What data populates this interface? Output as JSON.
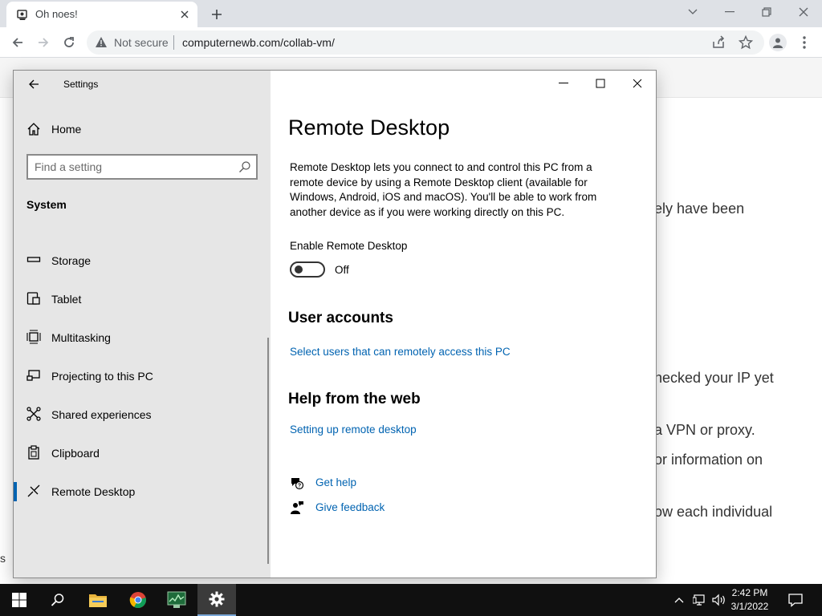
{
  "browser": {
    "tab_title": "Oh noes!",
    "not_secure_label": "Not secure",
    "url": "computernewb.com/collab-vm/"
  },
  "background_page": {
    "fragments": [
      "ely have been",
      "hecked your IP yet",
      "a VPN or proxy.",
      "or information on",
      "ow each individual",
      "s"
    ]
  },
  "settings": {
    "window_title": "Settings",
    "home_label": "Home",
    "search_placeholder": "Find a setting",
    "section_title": "System",
    "nav_items": [
      {
        "label": "Storage",
        "icon": "storage-icon"
      },
      {
        "label": "Tablet",
        "icon": "tablet-icon"
      },
      {
        "label": "Multitasking",
        "icon": "multitasking-icon"
      },
      {
        "label": "Projecting to this PC",
        "icon": "projecting-icon"
      },
      {
        "label": "Shared experiences",
        "icon": "shared-experiences-icon"
      },
      {
        "label": "Clipboard",
        "icon": "clipboard-icon"
      },
      {
        "label": "Remote Desktop",
        "icon": "remote-desktop-icon",
        "active": true
      }
    ],
    "page": {
      "title": "Remote Desktop",
      "description": "Remote Desktop lets you connect to and control this PC from a remote device by using a Remote Desktop client (available for Windows, Android, iOS and macOS). You'll be able to work from another device as if you were working directly on this PC.",
      "toggle_label": "Enable Remote Desktop",
      "toggle_state": "Off",
      "toggle_on": false,
      "user_accounts_heading": "User accounts",
      "user_accounts_link": "Select users that can remotely access this PC",
      "help_heading": "Help from the web",
      "help_link": "Setting up remote desktop",
      "get_help": "Get help",
      "give_feedback": "Give feedback"
    }
  },
  "taskbar": {
    "time": "2:42 PM",
    "date": "3/1/2022",
    "apps": [
      "file-explorer-icon",
      "chrome-icon",
      "task-manager-icon",
      "settings-icon"
    ]
  },
  "colors": {
    "accent": "#0063b1",
    "sidebar_bg": "#e6e6e6",
    "taskbar_bg": "#101010"
  }
}
